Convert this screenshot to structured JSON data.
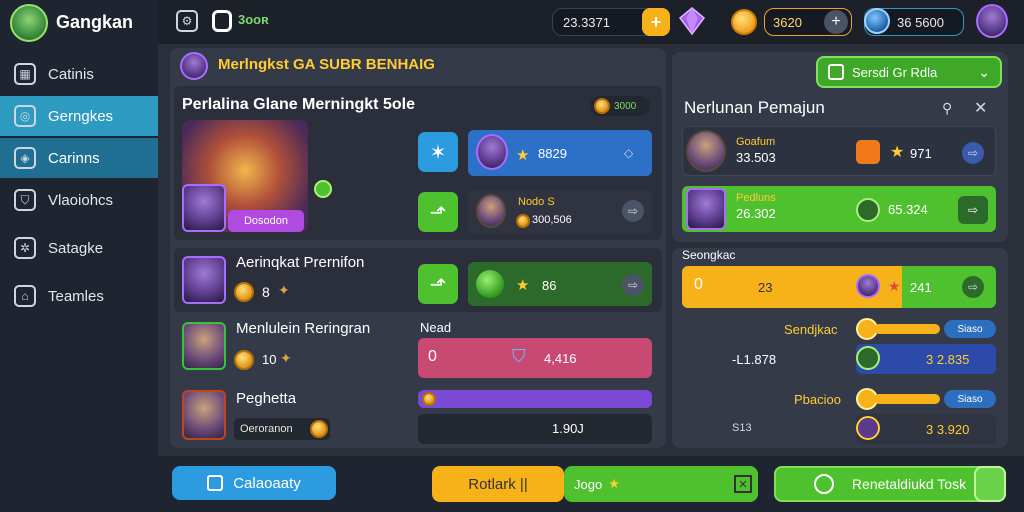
{
  "app": {
    "title": "Gangkan"
  },
  "sidebar": {
    "items": [
      {
        "label": "Catinis",
        "icon": "grid-icon"
      },
      {
        "label": "Gerngkes",
        "icon": "globe-icon"
      },
      {
        "label": "Carinns",
        "icon": "compass-icon"
      },
      {
        "label": "Vlaoiohcs",
        "icon": "shield-icon"
      },
      {
        "label": "Satagke",
        "icon": "gear-icon"
      },
      {
        "label": "Teamles",
        "icon": "home-icon"
      }
    ]
  },
  "topbar": {
    "badge_value": "3ooʀ",
    "currency1_value": "23.3371",
    "currency2_value": "3620",
    "currency3_value": "36 5600"
  },
  "left_panel": {
    "header_title": "Merlngkst GA SUBR BENHAIG",
    "card_title": "Perlalina Glane Merningkt 5ole",
    "card_badge": "3000",
    "hero_tag": "Dosodon",
    "rows": [
      {
        "value": "8829"
      },
      {
        "name": "Nodo S",
        "value": "300,506"
      },
      {
        "value": "86"
      }
    ],
    "players": [
      {
        "name": "Aerinqkat Prernifon",
        "value": "8"
      },
      {
        "name": "Menlulein Reringran",
        "value": "10"
      },
      {
        "name": "Peghetta",
        "tag": "Oeroranon"
      }
    ],
    "need_label": "Nead",
    "pink_bar": {
      "left": "0",
      "value": "4,416"
    },
    "dark_bar_value": "1.90J"
  },
  "right_panel": {
    "top_button": "Sersdi Gr Rdla",
    "title": "Nerlunan Pemajun",
    "entries": [
      {
        "name": "Goafum",
        "value": "33.503",
        "score": "971"
      },
      {
        "name": "Pedluns",
        "value": "26.302",
        "score": "65.324"
      }
    ],
    "section_label": "Seongkac",
    "yellow_bar": {
      "left": "0",
      "mid": "23",
      "right": "241"
    },
    "stat_rows": [
      {
        "label": "Sendjkac",
        "badge": "Siaso"
      },
      {
        "label": "-L1.878",
        "value": "3 2.835"
      },
      {
        "label": "Pbacioo",
        "badge": "Siaso"
      },
      {
        "label": "S13",
        "value": "3 3.920"
      }
    ]
  },
  "footer": {
    "btn_left": "Calaoaaty",
    "btn_mid_left": "Rotlark ||",
    "btn_mid_right": "Jogo",
    "btn_right": "Renetaldiukd Tosk"
  },
  "colors": {
    "accent_blue": "#2d9bbf",
    "accent_green": "#4fc02e",
    "accent_yellow": "#f7b21a",
    "accent_pink": "#d0527a",
    "accent_purple": "#7a4ad6"
  }
}
